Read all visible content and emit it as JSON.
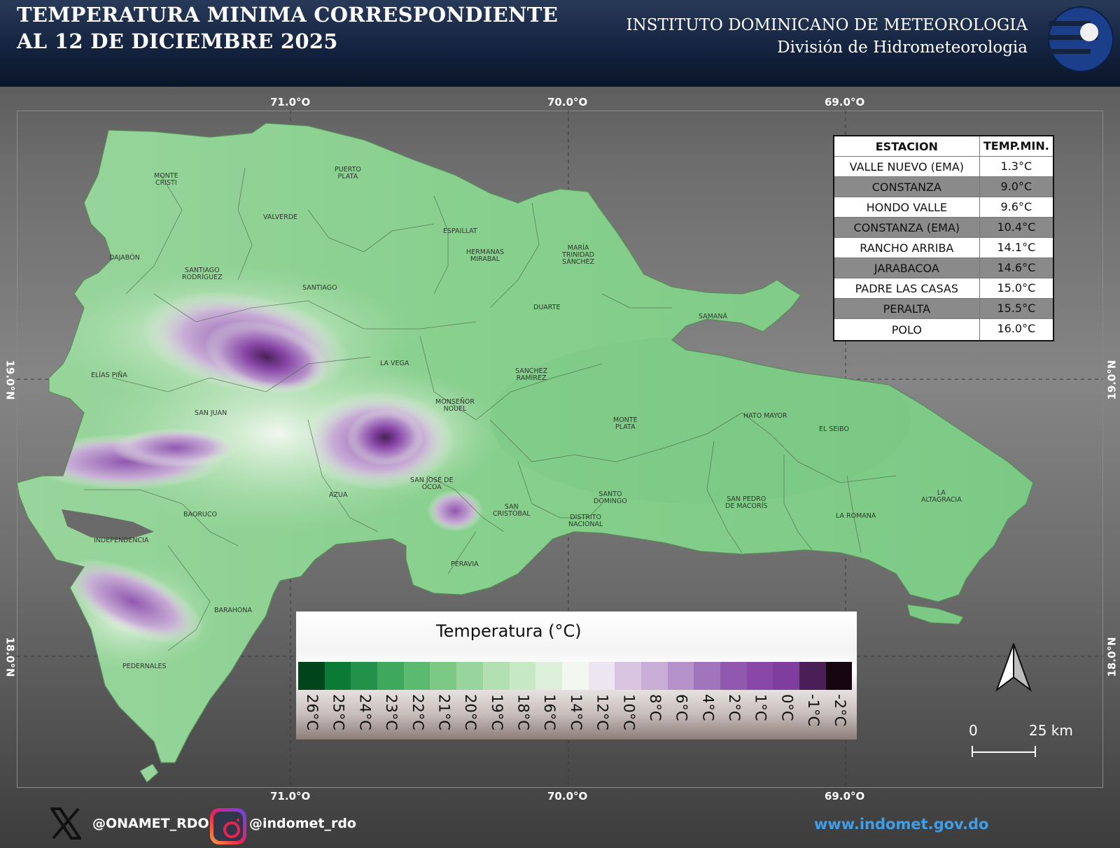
{
  "header": {
    "title_line1": "TEMPERATURA MINIMA CORRESPONDIENTE",
    "title_line2": "AL 12 DE DICIEMBRE 2025",
    "institute": "INSTITUTO DOMINICANO DE METEOROLOGIA",
    "division": "División de Hidrometeorologia",
    "logo_icon": "indomet-logo-icon"
  },
  "coords": {
    "lon_labels": [
      "71.0°O",
      "70.0°O",
      "69.0°O"
    ],
    "lat_labels": [
      "19.0°N",
      "18.0°N"
    ]
  },
  "provinces": {
    "monte_cristi": "MONTE\nCRISTI",
    "puerto_plata": "PUERTO\nPLATA",
    "valverde": "VALVERDE",
    "espaillat": "ESPAILLAT",
    "hermanas_mirabal": "HERMANAS\nMIRABAL",
    "maria_trinidad_sanchez": "MARÍA\nTRINIDAD\nSÁNCHEZ",
    "dajabon": "DAJABÓN",
    "santiago_rodriguez": "SANTIAGO\nRODRÍGUEZ",
    "santiago": "SANTIAGO",
    "duarte": "DUARTE",
    "samana": "SAMANÁ",
    "elias_pina": "ELÍAS PIÑA",
    "la_vega": "LA VEGA",
    "sanchez_ramirez": "SANCHEZ\nRAMÍREZ",
    "monsenor_nouel": "MONSEÑOR\nNOUEL",
    "san_juan": "SAN JUAN",
    "monte_plata": "MONTE\nPLATA",
    "hato_mayor": "HATO MAYOR",
    "el_seibo": "EL SEIBO",
    "san_jose_de_ocoa": "SAN JOSÉ DE\nOCOA",
    "azua": "AZUA",
    "la_altagracia": "LA\nALTAGRACIA",
    "santo_domingo": "SANTO\nDOMINGO",
    "san_pedro_de_macoris": "SAN PEDRO\nDE MACORÍS",
    "baoruco": "BAORUCO",
    "san_cristobal": "SAN\nCRISTÓBAL",
    "distrito_nacional": "DISTRITO\nNACIONAL",
    "la_romana": "LA ROMANA",
    "independencia": "INDEPENDENCIA",
    "peravia": "PERAVIA",
    "barahona": "BARAHONA",
    "pedernales": "PEDERNALES"
  },
  "station_table": {
    "col_station": "ESTACION",
    "col_temp": "TEMP.MIN.",
    "rows": [
      {
        "station": "VALLE NUEVO (EMA)",
        "temp": "1.3°C"
      },
      {
        "station": "CONSTANZA",
        "temp": "9.0°C"
      },
      {
        "station": "HONDO VALLE",
        "temp": "9.6°C"
      },
      {
        "station": "CONSTANZA (EMA)",
        "temp": "10.4°C"
      },
      {
        "station": "RANCHO ARRIBA",
        "temp": "14.1°C"
      },
      {
        "station": "JARABACOA",
        "temp": "14.6°C"
      },
      {
        "station": "PADRE LAS CASAS",
        "temp": "15.0°C"
      },
      {
        "station": "PERALTA",
        "temp": "15.5°C"
      },
      {
        "station": "POLO",
        "temp": "16.0°C"
      }
    ]
  },
  "legend": {
    "title": "Temperatura (°C)",
    "classes": [
      {
        "label": "26°C",
        "color": "#00441b"
      },
      {
        "label": "25°C",
        "color": "#0b7a34"
      },
      {
        "label": "24°C",
        "color": "#23914a"
      },
      {
        "label": "23°C",
        "color": "#3ea85d"
      },
      {
        "label": "22°C",
        "color": "#5cb970"
      },
      {
        "label": "21°C",
        "color": "#7cc986"
      },
      {
        "label": "20°C",
        "color": "#98d59c"
      },
      {
        "label": "19°C",
        "color": "#b3e0b3"
      },
      {
        "label": "18°C",
        "color": "#c6e8c2"
      },
      {
        "label": "16°C",
        "color": "#dcf0d9"
      },
      {
        "label": "14°C",
        "color": "#f2f8f0"
      },
      {
        "label": "12°C",
        "color": "#ede6f1"
      },
      {
        "label": "10°C",
        "color": "#d9c5e2"
      },
      {
        "label": "8°C",
        "color": "#c8aed6"
      },
      {
        "label": "6°C",
        "color": "#b592c9"
      },
      {
        "label": "4°C",
        "color": "#a175bb"
      },
      {
        "label": "2°C",
        "color": "#9158b0"
      },
      {
        "label": "1°C",
        "color": "#8947a8"
      },
      {
        "label": "0°C",
        "color": "#7f3d9d"
      },
      {
        "label": "-1°C",
        "color": "#4a1f58"
      },
      {
        "label": "-2°C",
        "color": "#15060f"
      }
    ]
  },
  "scale_bar": {
    "start": "0",
    "end": "25 km"
  },
  "north_arrow_icon": "north-arrow-icon",
  "footer": {
    "x_handle": "@ONAMET_RDO",
    "instagram_handle": "@indomet_rdo",
    "website": "www.indomet.gov.do",
    "x_icon": "x-logo-icon",
    "instagram_icon": "instagram-icon"
  },
  "colors": {
    "header_bg": "#14233f",
    "map_green": "#7cc986",
    "map_purple": "#8947a8",
    "website": "#3f9ee8"
  }
}
